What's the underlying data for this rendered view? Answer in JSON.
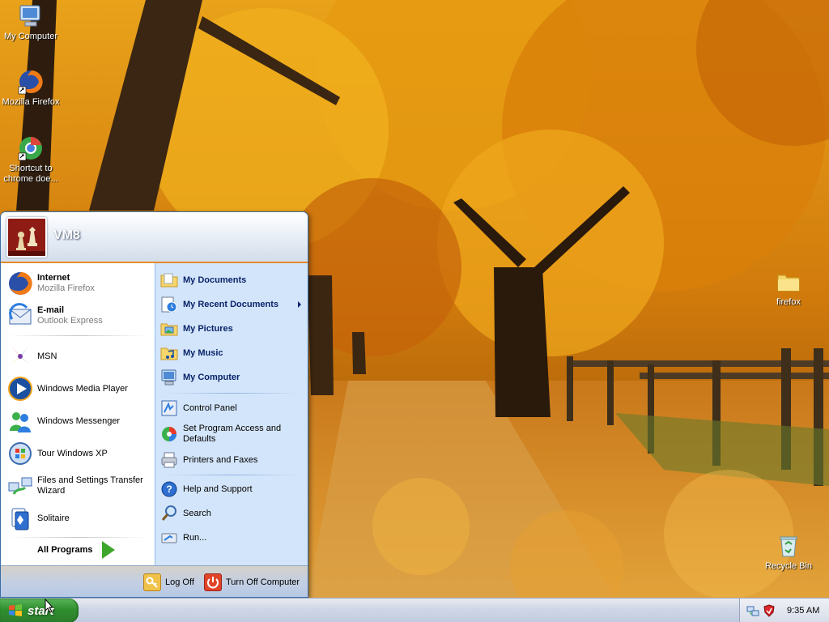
{
  "desktop": {
    "icons": [
      {
        "label": "My Computer",
        "icon": "my-computer-icon"
      },
      {
        "label": "Mozilla Firefox",
        "icon": "firefox-icon"
      },
      {
        "label": "Shortcut to chrome doe...",
        "icon": "chrome-shortcut-icon"
      },
      {
        "label": "firefox",
        "icon": "folder-icon"
      },
      {
        "label": "Recycle Bin",
        "icon": "recycle-bin-icon"
      }
    ]
  },
  "start_menu": {
    "user_name": "VM8",
    "pinned": [
      {
        "title": "Internet",
        "subtitle": "Mozilla Firefox",
        "icon": "firefox-icon"
      },
      {
        "title": "E-mail",
        "subtitle": "Outlook Express",
        "icon": "outlook-express-icon"
      }
    ],
    "recent": [
      {
        "label": "MSN",
        "icon": "msn-icon"
      },
      {
        "label": "Windows Media Player",
        "icon": "media-player-icon"
      },
      {
        "label": "Windows Messenger",
        "icon": "messenger-icon"
      },
      {
        "label": "Tour Windows XP",
        "icon": "tour-xp-icon"
      },
      {
        "label": "Files and Settings Transfer Wizard",
        "icon": "transfer-wizard-icon"
      },
      {
        "label": "Solitaire",
        "icon": "solitaire-icon"
      }
    ],
    "all_programs": "All Programs",
    "places": [
      {
        "label": "My Documents",
        "icon": "documents-folder-icon"
      },
      {
        "label": "My Recent Documents",
        "icon": "recent-documents-icon"
      },
      {
        "label": "My Pictures",
        "icon": "pictures-folder-icon"
      },
      {
        "label": "My Music",
        "icon": "music-folder-icon"
      },
      {
        "label": "My Computer",
        "icon": "my-computer-icon"
      }
    ],
    "system": [
      {
        "label": "Control Panel",
        "icon": "control-panel-icon"
      },
      {
        "label": "Set Program Access and Defaults",
        "icon": "program-access-icon"
      },
      {
        "label": "Printers and Faxes",
        "icon": "printer-icon"
      }
    ],
    "support": [
      {
        "label": "Help and Support",
        "icon": "help-icon"
      },
      {
        "label": "Search",
        "icon": "search-icon"
      },
      {
        "label": "Run...",
        "icon": "run-icon"
      }
    ],
    "log_off": "Log Off",
    "turn_off": "Turn Off Computer"
  },
  "taskbar": {
    "start_label": "start",
    "clock": "9:35 AM",
    "tray_icons": [
      "network-icon",
      "security-shield-icon"
    ]
  },
  "colors": {
    "start_green": "#2f8f2f",
    "menu_blue": "#d3e5fa",
    "accent_orange": "#e58a2a"
  }
}
